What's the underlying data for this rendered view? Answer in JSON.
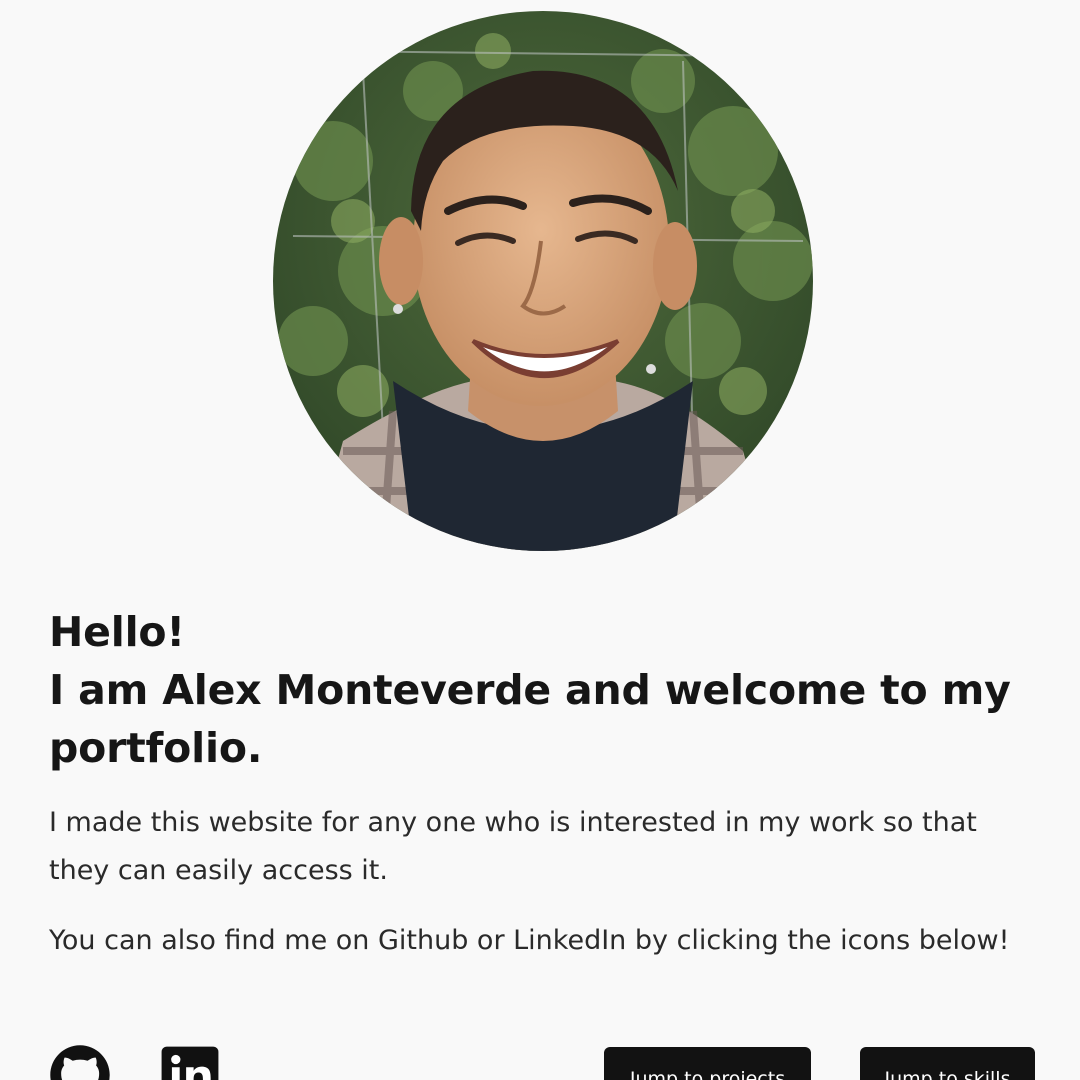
{
  "profile": {
    "photo_alt": "profile-photo"
  },
  "intro": {
    "greeting": "Hello!",
    "headline_line2": "I am Alex Monteverde and welcome to my",
    "headline_line3": "portfolio.",
    "paragraph1": "I made this website for any one who is interested in my work so that they can easily access it.",
    "paragraph2": "You can also find me on Github or LinkedIn by clicking the icons below!"
  },
  "social": {
    "github_icon": "github-icon",
    "linkedin_icon": "linkedin-icon"
  },
  "buttons": {
    "projects_label": "Jump to projects",
    "skills_label": "Jump to skills"
  }
}
